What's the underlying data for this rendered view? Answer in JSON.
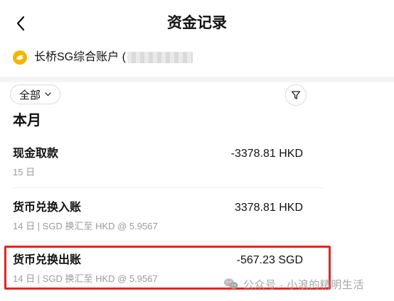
{
  "header": {
    "title": "资金记录"
  },
  "account": {
    "name": "长桥SG综合账户 ("
  },
  "filter": {
    "label": "全部"
  },
  "month_heading": "本月",
  "transactions": [
    {
      "title": "现金取款",
      "amount": "-3378.81 HKD",
      "subtitle": "15 日"
    },
    {
      "title": "货币兑换入账",
      "amount": "3378.81 HKD",
      "subtitle": "14 日 | SGD 换汇至 HKD @ 5.9567"
    },
    {
      "title": "货币兑换出账",
      "amount": "-567.23 SGD",
      "subtitle": "14 日 | SGD 换汇至 HKD @ 5.9567"
    }
  ],
  "watermark": {
    "text": "公众号 · 小浪的精明生活"
  },
  "colors": {
    "accent_yellow": "#f2b600",
    "highlight_red": "#e8231c",
    "subtle_gray": "#9a9a9a"
  },
  "icons": {
    "back": "chevron-left-icon",
    "account": "longbridge-logo-icon",
    "dropdown": "chevron-down-icon",
    "filter": "filter-funnel-icon",
    "watermark": "wechat-icon"
  }
}
